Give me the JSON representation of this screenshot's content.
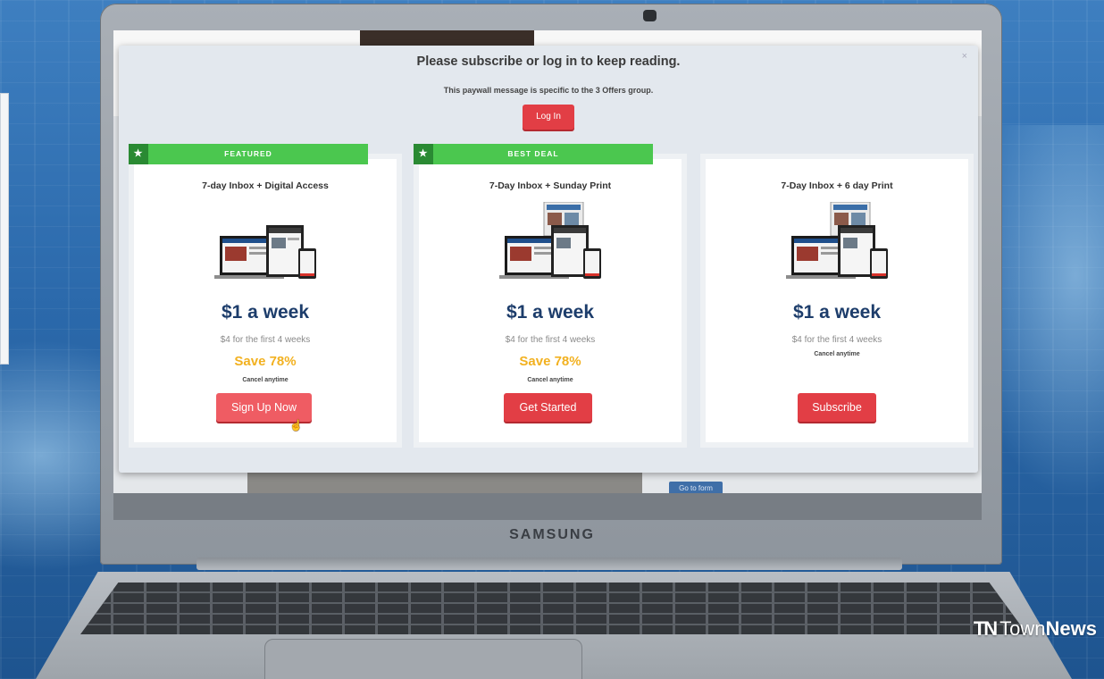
{
  "modal": {
    "title": "Please subscribe or log in to keep reading.",
    "subtitle": "This paywall message is specific to the 3 Offers group.",
    "close_glyph": "×",
    "login_label": "Log In"
  },
  "offers": [
    {
      "banner": "FEATURED",
      "name": "7-day Inbox + Digital Access",
      "price": "$1 a week",
      "intro": "$4 for the first 4 weeks",
      "save": "Save 78%",
      "cancel": "Cancel anytime",
      "button": "Sign Up Now"
    },
    {
      "banner": "BEST DEAL",
      "name": "7-Day Inbox + Sunday Print",
      "price": "$1 a week",
      "intro": "$4 for the first 4 weeks",
      "save": "Save 78%",
      "cancel": "Cancel anytime",
      "button": "Get Started"
    },
    {
      "name": "7-Day Inbox + 6 day Print",
      "price": "$1 a week",
      "intro": "$4 for the first 4 weeks",
      "cancel": "Cancel anytime",
      "button": "Subscribe"
    }
  ],
  "background_site": {
    "go_to_form": "Go to form"
  },
  "laptop": {
    "brand": "SAMSUNG"
  },
  "watermark": {
    "mark": "TN",
    "town": "Town",
    "news": "News"
  },
  "colors": {
    "accent_red": "#e23e45",
    "banner_green": "#4bc74f",
    "price_blue": "#1d3d6b",
    "save_gold": "#f2b120"
  },
  "icons": {
    "banner_star": "star-icon",
    "cursor": "pointer-cursor-icon"
  }
}
